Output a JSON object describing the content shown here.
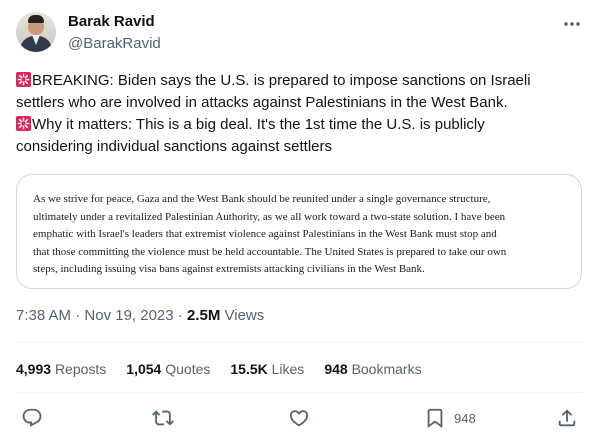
{
  "author": {
    "name": "Barak Ravid",
    "handle": "@BarakRavid"
  },
  "tweet": {
    "lines": [
      "BREAKING: Biden says the U.S. is prepared to impose sanctions on Israeli",
      "settlers who are involved in attacks against Palestinians in the West Bank.",
      "Why it matters: This is a big deal. It's the 1st time the U.S. is publicly",
      "considering individual sanctions against settlers"
    ]
  },
  "media": {
    "lines": [
      "As we strive for peace, Gaza and the West Bank should be reunited under a single governance structure,",
      "ultimately under a revitalized Palestinian Authority, as we all work toward a two-state solution. I have been",
      "emphatic with Israel's leaders that extremist violence against Palestinians in the West Bank must stop and",
      "that those committing the violence must be held accountable. The United States is prepared to take our own",
      "steps, including issuing visa bans against extremists attacking civilians in the West Bank."
    ]
  },
  "meta": {
    "time": "7:38 AM",
    "separator": "·",
    "date": "Nov 19, 2023",
    "views_count": "2.5M",
    "views_label": "Views"
  },
  "stats": {
    "reposts": {
      "num": "4,993",
      "label": "Reposts"
    },
    "quotes": {
      "num": "1,054",
      "label": "Quotes"
    },
    "likes": {
      "num": "15.5K",
      "label": "Likes"
    },
    "bookmarks": {
      "num": "948",
      "label": "Bookmarks"
    }
  },
  "actions": {
    "bookmark_count": "948"
  },
  "colors": {
    "text": "#0f1419",
    "secondary": "#536471",
    "border": "#cfd9de",
    "siren": "#e0245e"
  },
  "icons": [
    "more-icon",
    "siren-emoji",
    "reply-icon",
    "repost-icon",
    "like-icon",
    "bookmark-icon",
    "share-icon"
  ]
}
